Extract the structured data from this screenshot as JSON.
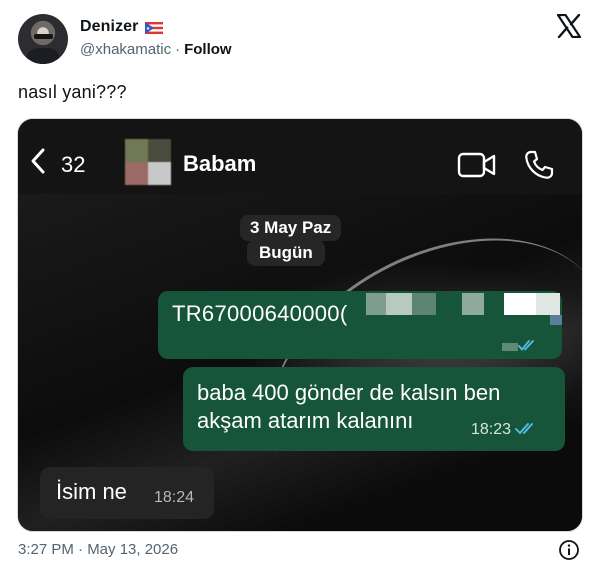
{
  "tweet": {
    "author": {
      "display_name": "Denizer",
      "flag_icon": "puerto-rico-flag-icon",
      "handle": "@xhakamatic",
      "separator": "·",
      "follow_label": "Follow"
    },
    "text": "nasıl yani???",
    "timestamp": "3:27 PM · May 13, 2026",
    "brand_icon": "x-logo-icon",
    "info_icon": "info-icon"
  },
  "screenshot": {
    "header": {
      "back_count": "32",
      "contact_name": "Babam",
      "video_icon": "video-call-icon",
      "phone_icon": "phone-call-icon"
    },
    "date_label": "3 May Paz",
    "day_label": "Bugün",
    "messages": [
      {
        "direction": "outgoing",
        "text": "TR67000640000(",
        "time": "",
        "status": "read"
      },
      {
        "direction": "outgoing",
        "text": "baba 400 gönder de kalsın ben akşam atarım kalanını",
        "time": "18:23",
        "status": "read"
      },
      {
        "direction": "incoming",
        "text": "İsim ne",
        "time": "18:24"
      }
    ]
  },
  "colors": {
    "outgoing_bubble": "#16553a",
    "incoming_bubble": "#242425",
    "read_ticks": "#53bdeb",
    "handle_gray": "#536471"
  }
}
